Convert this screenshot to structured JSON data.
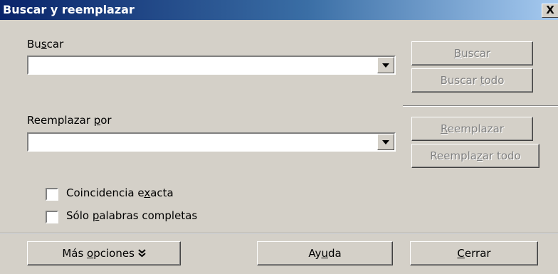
{
  "window": {
    "title": "Buscar y reemplazar",
    "close_label": "X"
  },
  "search": {
    "label_pre": "Bu",
    "label_u": "s",
    "label_post": "car",
    "value": ""
  },
  "replace": {
    "label_pre": "Reemplazar ",
    "label_u": "p",
    "label_post": "or",
    "value": ""
  },
  "buttons": {
    "find": {
      "pre": "",
      "u": "B",
      "post": "uscar"
    },
    "find_all": {
      "pre": "Buscar ",
      "u": "t",
      "post": "odo"
    },
    "replace": {
      "pre": "",
      "u": "R",
      "post": "eemplazar"
    },
    "replace_all": {
      "pre": "Reempla",
      "u": "z",
      "post": "ar todo"
    },
    "more_options": {
      "pre": "Más ",
      "u": "o",
      "post": "pciones",
      "icon": "double-chevron-down-icon"
    },
    "help": {
      "pre": "Ay",
      "u": "u",
      "post": "da"
    },
    "close": {
      "pre": "",
      "u": "C",
      "post": "errar"
    }
  },
  "options": {
    "match_case": {
      "pre": "Coincidencia e",
      "u": "x",
      "post": "acta",
      "checked": false
    },
    "whole_words": {
      "pre": "Sólo ",
      "u": "p",
      "post": "alabras completas",
      "checked": false
    }
  }
}
